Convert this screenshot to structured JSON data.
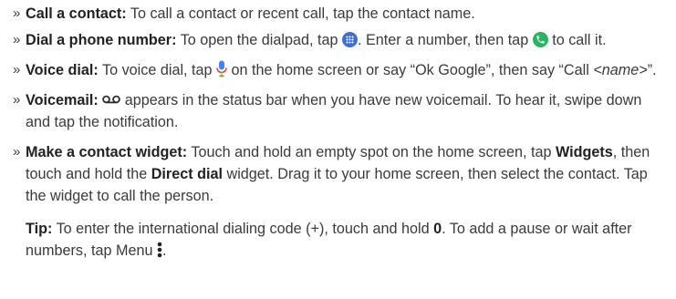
{
  "bullet_glyph": "»",
  "items": [
    {
      "lead": "Call a contact:",
      "text": " To call a contact or recent call, tap the contact name."
    },
    {
      "lead": "Dial a phone number:",
      "text_a": " To open the dialpad, tap ",
      "text_b": ". Enter a number, then tap ",
      "text_c": " to call it."
    },
    {
      "lead": "Voice dial:",
      "text_a": " To voice dial, tap ",
      "text_b": " on the home screen or say “Ok Google”, then say “Call ",
      "text_name": "<name>",
      "text_c": "”."
    },
    {
      "lead": "Voicemail:",
      "text": " appears in the status bar when you have new voicemail. To hear it, swipe down and tap the notification."
    },
    {
      "lead": "Make a contact widget:",
      "text_a": " Touch and hold an empty spot on the home screen, tap ",
      "bold_1": "Widgets",
      "text_b": ", then touch and hold the ",
      "bold_2": "Direct dial",
      "text_c": " widget. Drag it to your home screen, then select the contact. Tap the widget to call the person."
    }
  ],
  "tip": {
    "lead": "Tip:",
    "text_a": " To enter the international dialing code (+), touch and hold ",
    "bold": "0",
    "text_b": ". To add a pause or wait after numbers, tap Menu ",
    "text_c": "."
  },
  "icons": {
    "dialpad": "dialpad-icon",
    "call": "phone-call-icon",
    "mic": "microphone-icon",
    "voicemail": "voicemail-icon",
    "menu": "menu-more-icon"
  },
  "colors": {
    "dialpad_blue": "#3d6fd6",
    "call_green": "#28b463",
    "mic_blue": "#4285f4",
    "mic_red": "#ea4335",
    "mic_yellow": "#fbbc05",
    "mic_green": "#34a853"
  }
}
